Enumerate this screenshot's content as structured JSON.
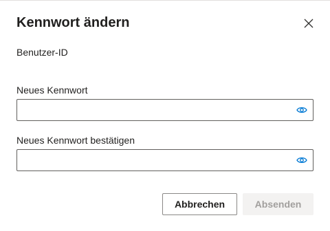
{
  "dialog": {
    "title": "Kennwort ändern",
    "user_id_label": "Benutzer-ID",
    "new_password_label": "Neues Kennwort",
    "new_password_value": "",
    "confirm_password_label": "Neues Kennwort bestätigen",
    "confirm_password_value": "",
    "cancel_label": "Abbrechen",
    "submit_label": "Absenden",
    "submit_enabled": false
  },
  "icons": {
    "close": "close-icon",
    "reveal": "eye-icon"
  },
  "colors": {
    "accent": "#0078d4",
    "disabled_bg": "#f3f2f1",
    "disabled_text": "#a19f9d"
  }
}
